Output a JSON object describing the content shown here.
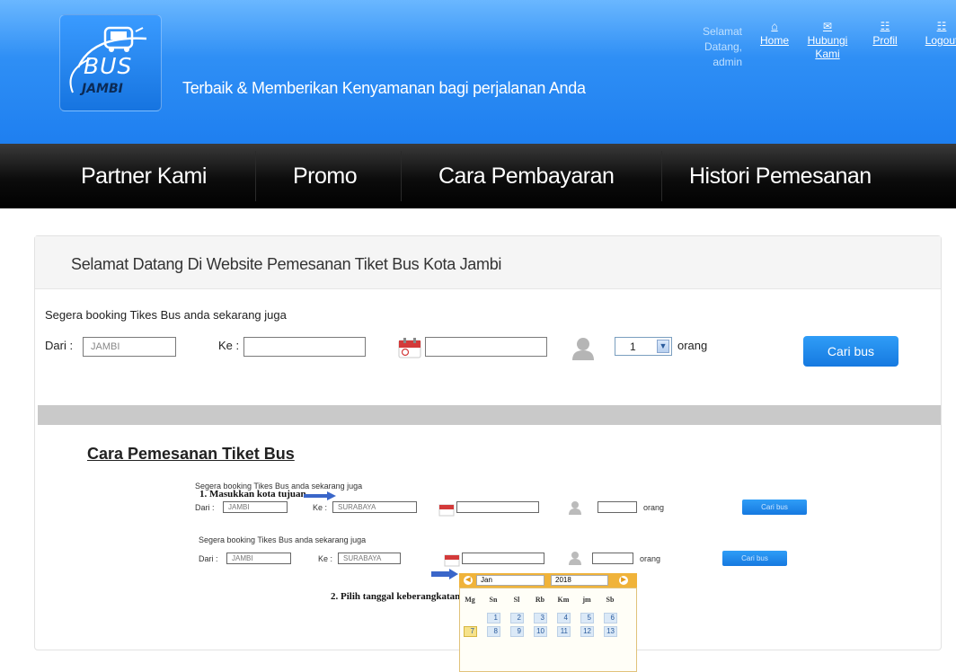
{
  "header": {
    "logo_bus": "BUS",
    "logo_city": "JAMBI",
    "tagline": "Terbaik & Memberikan Kenyamanan bagi perjalanan Anda",
    "welcome": "Selamat Datang, admin",
    "nav": [
      {
        "label": "Home",
        "icon": "home-icon"
      },
      {
        "label": "Hubungi Kami",
        "icon": "mail-icon"
      },
      {
        "label": "Profil",
        "icon": "profile-icon"
      },
      {
        "label": "Logout",
        "icon": "logout-icon"
      }
    ]
  },
  "menu": [
    "Partner Kami",
    "Promo",
    "Cara Pembayaran",
    "Histori Pemesanan"
  ],
  "main": {
    "title": "Selamat Datang Di Website Pemesanan Tiket Bus Kota Jambi",
    "subtitle": "Segera booking Tikes Bus anda sekarang juga",
    "from_label": "Dari :",
    "from_value": "JAMBI",
    "to_label": "Ke :",
    "to_value": "",
    "date_value": "",
    "passenger_count": "1",
    "passenger_unit": "orang",
    "search_button": "Cari bus"
  },
  "guide": {
    "title": "Cara Pemesanan Tiket Bus",
    "subtitle": "Segera booking Tikes Bus anda sekarang juga",
    "step1": "1. Masukkan kota tujuan",
    "step2": "2. Pilih tanggal keberangkatan",
    "from_label": "Dari :",
    "from_value": "JAMBI",
    "to_label": "Ke :",
    "to_value": "SURABAYA",
    "unit": "orang",
    "button": "Cari bus",
    "calendar": {
      "month": "Jan",
      "year": "2018",
      "weekdays": [
        "Mg",
        "Sn",
        "Sl",
        "Rb",
        "Km",
        "jm",
        "Sb"
      ],
      "row1": [
        "1",
        "2",
        "3",
        "4",
        "5",
        "6"
      ],
      "row2": [
        "7",
        "8",
        "9",
        "10",
        "11",
        "12",
        "13"
      ]
    }
  },
  "colors": {
    "header_blue": "#2f8ff5",
    "menu_black": "#0c0c0c",
    "button_blue": "#1679e0",
    "calendar_orange": "#f0b33a"
  }
}
